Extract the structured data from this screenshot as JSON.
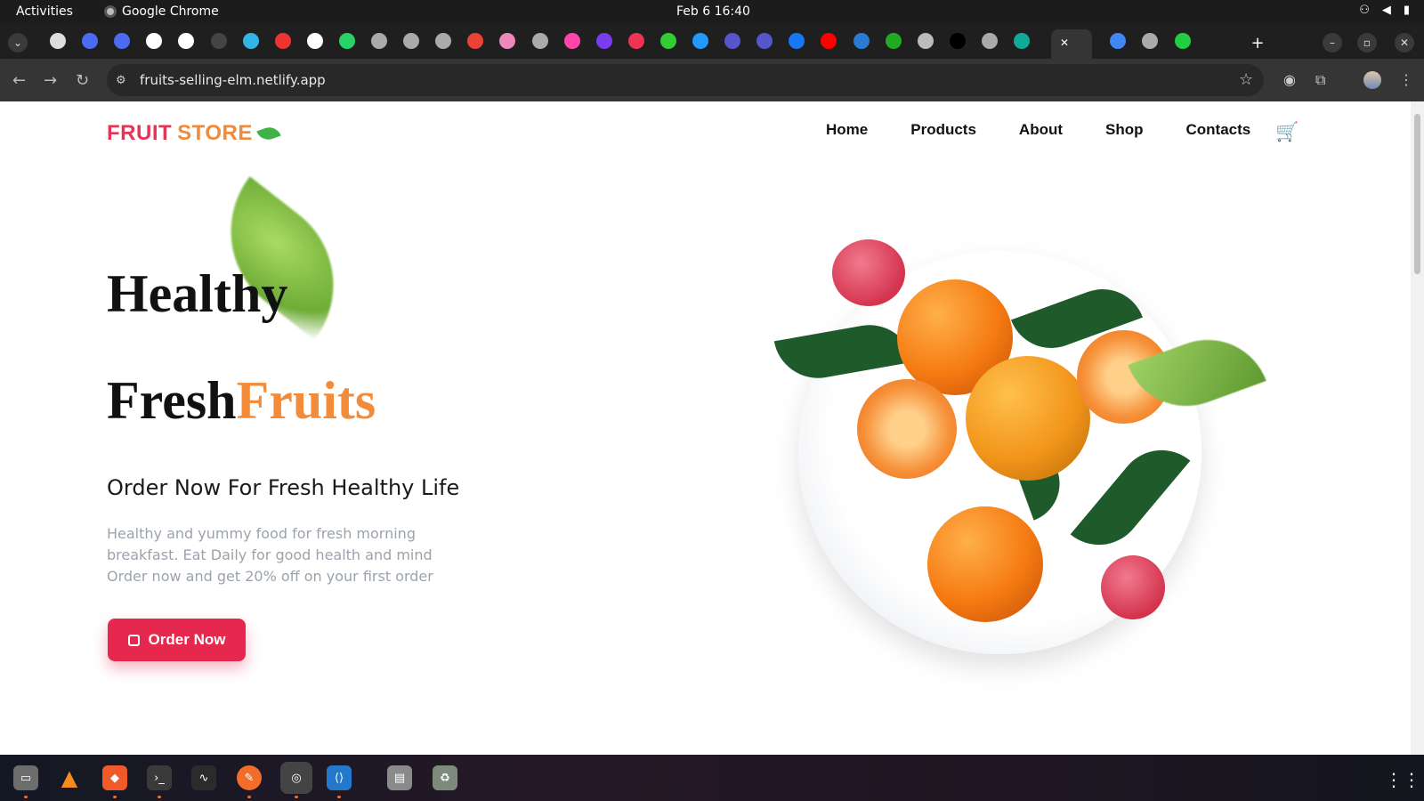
{
  "system": {
    "activities": "Activities",
    "app_name": "Google Chrome",
    "clock": "Feb 6  16:40"
  },
  "browser": {
    "url": "fruits-selling-elm.netlify.app",
    "new_tab": "+",
    "minimize": "–",
    "restore": "▫",
    "close": "✕"
  },
  "site": {
    "logo_part1": "FRUIT",
    "logo_part2": "STORE",
    "nav": [
      "Home",
      "Products",
      "About",
      "Shop",
      "Contacts"
    ],
    "hero_line1": "Healthy",
    "hero_line2_black": "Fresh",
    "hero_line2_orange": "Fruits",
    "subheading": "Order Now For Fresh Healthy Life",
    "description": "Healthy and yummy food for fresh morning breakfast. Eat Daily for good health and mind Order now and get 20% off on your first order",
    "cta": "Order Now"
  },
  "colors": {
    "brand_red": "#e63554",
    "brand_orange": "#f08a3c",
    "cta_bg": "#e6284e"
  }
}
